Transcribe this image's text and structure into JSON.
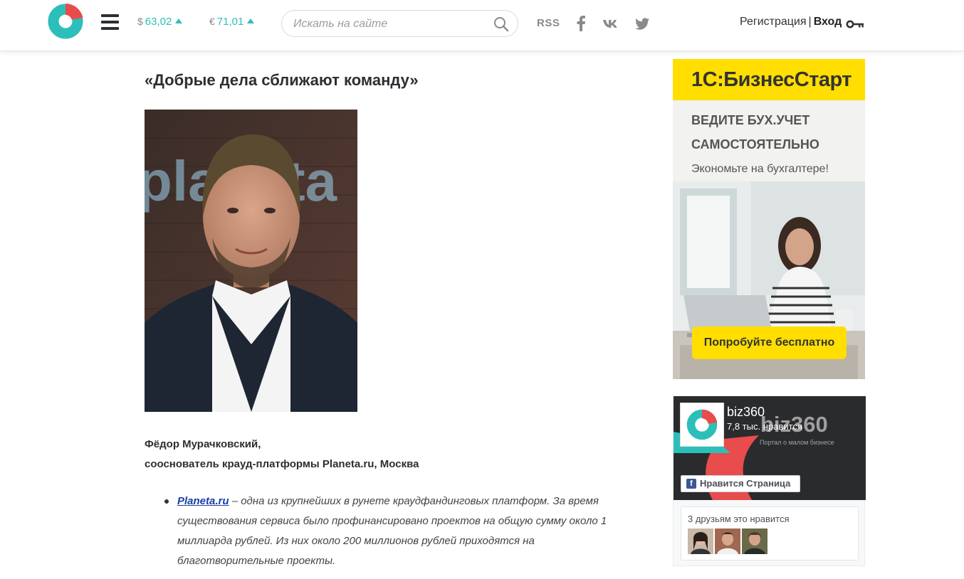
{
  "header": {
    "currency": [
      {
        "symbol": "$",
        "value": "63,02",
        "trend": "up"
      },
      {
        "symbol": "€",
        "value": "71,01",
        "trend": "up"
      }
    ],
    "search": {
      "placeholder": "Искать на сайте"
    },
    "rss_label": "RSS",
    "social_icons": [
      "facebook-icon",
      "vk-icon",
      "twitter-icon"
    ],
    "register_label": "Регистрация",
    "separator": "|",
    "login_label": "Вход"
  },
  "article": {
    "title": "«Добрые дела сближают команду»",
    "caption_name": "Фёдор Мурачковский,",
    "caption_role": "сооснователь крауд-платформы Planeta.ru, Москва",
    "bullet_link": "Planeta.ru",
    "bullet_text": " – одна из крупнейших в рунете краудфандинговых платформ. За время существования сервиса было профинансировано проектов на общую сумму около 1 миллиарда рублей. Из них около 200 миллионов рублей приходятся на благотворительные проекты."
  },
  "ad": {
    "brand": "1С:БизнесСтарт",
    "line1": "ВЕДИТЕ БУХ.УЧЕТ",
    "line2": "САМОСТОЯТЕЛЬНО",
    "line3": "Экономьте на бухгалтере!",
    "button": "Попробуйте бесплатно"
  },
  "fb_widget": {
    "page_name": "biz360",
    "likes": "7,8 тыс. нравится",
    "watermark": "biz360",
    "tagline": "Портал о малом бизнесе",
    "like_button": "Нравится Страница",
    "friends_text": "3 друзьям это нравится"
  },
  "colors": {
    "accent": "#2cbfba",
    "logo_red": "#e84c4c",
    "ad_yellow": "#ffde00",
    "link": "#1a3fa8",
    "fb_blue": "#3b5998"
  }
}
